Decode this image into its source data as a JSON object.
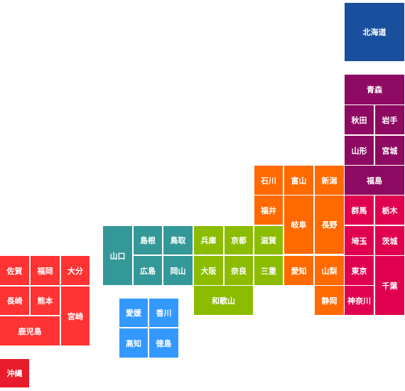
{
  "map": {
    "regions": {
      "hokkaido": {
        "color": "#1a4f9e"
      },
      "tohoku": {
        "color": "#8e0a62"
      },
      "kanto": {
        "color": "#e0004f"
      },
      "chubu": {
        "color": "#ff6a00"
      },
      "kinki": {
        "color": "#8cbc00"
      },
      "chugoku": {
        "color": "#349898"
      },
      "shikoku": {
        "color": "#3399ff"
      },
      "kyushu": {
        "color": "#ff3333"
      },
      "okinawa": {
        "color": "#e81c2a"
      }
    },
    "prefectures": {
      "hokkaido": "北海道",
      "aomori": "青森",
      "akita": "秋田",
      "iwate": "岩手",
      "yamagata": "山形",
      "miyagi": "宮城",
      "fukushima": "福島",
      "ishikawa": "石川",
      "toyama": "富山",
      "niigata": "新潟",
      "fukui": "福井",
      "gifu": "岐阜",
      "nagano": "長野",
      "aichi": "愛知",
      "yamanashi": "山梨",
      "shizuoka": "静岡",
      "gunma": "群馬",
      "tochigi": "栃木",
      "saitama": "埼玉",
      "ibaraki": "茨城",
      "tokyo": "東京",
      "chiba": "千葉",
      "kanagawa": "神奈川",
      "shiga": "滋賀",
      "mie": "三重",
      "hyogo": "兵庫",
      "kyoto": "京都",
      "osaka": "大阪",
      "nara": "奈良",
      "wakayama": "和歌山",
      "yamaguchi": "山口",
      "shimane": "島根",
      "tottori": "鳥取",
      "hiroshima": "広島",
      "okayama": "岡山",
      "ehime": "愛媛",
      "kagawa": "香川",
      "kochi": "高知",
      "tokushima": "徳島",
      "saga": "佐賀",
      "fukuoka": "福岡",
      "oita": "大分",
      "nagasaki": "長崎",
      "kumamoto": "熊本",
      "miyazaki": "宮崎",
      "kagoshima": "鹿児島",
      "okinawa": "沖縄"
    }
  }
}
